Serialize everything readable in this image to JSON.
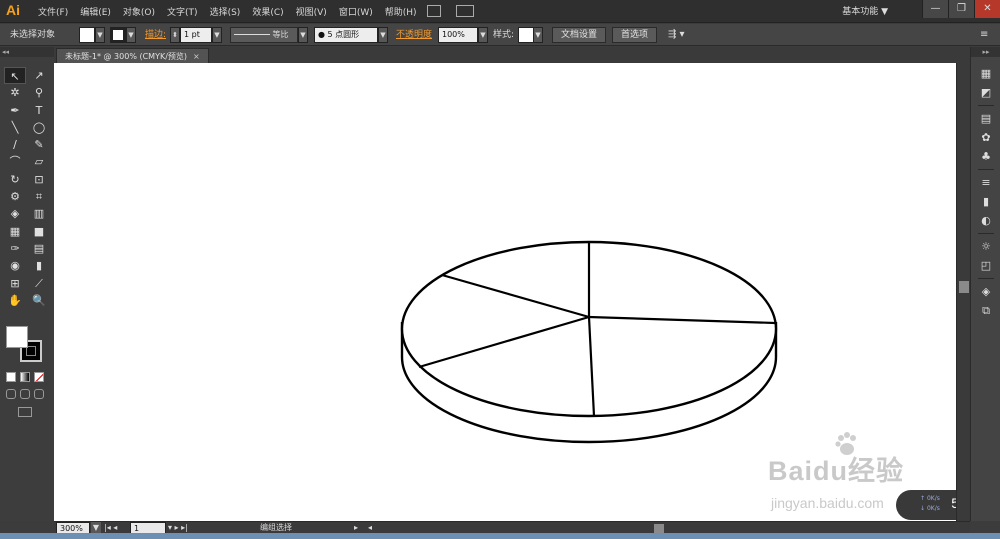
{
  "app": {
    "logo_text": "Ai",
    "menus": [
      "文件(F)",
      "编辑(E)",
      "对象(O)",
      "文字(T)",
      "选择(S)",
      "效果(C)",
      "视图(V)",
      "窗口(W)",
      "帮助(H)"
    ],
    "workspace_label": "基本功能",
    "workspace_arrow": "▼",
    "window_buttons": {
      "minimize": "—",
      "restore": "❐",
      "close": "✕"
    }
  },
  "control_bar": {
    "selection_status": "未选择对象",
    "stroke_label": "描边:",
    "stroke_weight": "1 pt",
    "stroke_profile": "等比",
    "brush_def": "● 5 点圆形",
    "opacity_label": "不透明度",
    "opacity_value": "100%",
    "style_label": "样式:",
    "doc_setup_button": "文档设置",
    "preferences_button": "首选项"
  },
  "document": {
    "tab_title": "未标题-1* @ 300% (CMYK/预览)",
    "tab_close": "×"
  },
  "tools": [
    "↖",
    "↗",
    "✲",
    "⚲",
    "✒",
    "T",
    "╲",
    "◯",
    "∕",
    "✎",
    "⌒",
    "▱",
    "↻",
    "⊡",
    "⚙",
    "⌗",
    "◈",
    "▥",
    "▦",
    "■",
    "✑",
    "▤",
    "◉",
    "▮",
    "⊞",
    "⟋",
    "✋",
    "🔍"
  ],
  "status_bar": {
    "zoom": "300%",
    "artboard_index": "1",
    "tool_status": "编组选择"
  },
  "watermark": {
    "brand": "Baidu经验",
    "url": "jingyan.baidu.com"
  },
  "speed_widget": {
    "percent": "54",
    "percent_symbol": "%",
    "up": "0K/s",
    "down": "0K/s"
  }
}
